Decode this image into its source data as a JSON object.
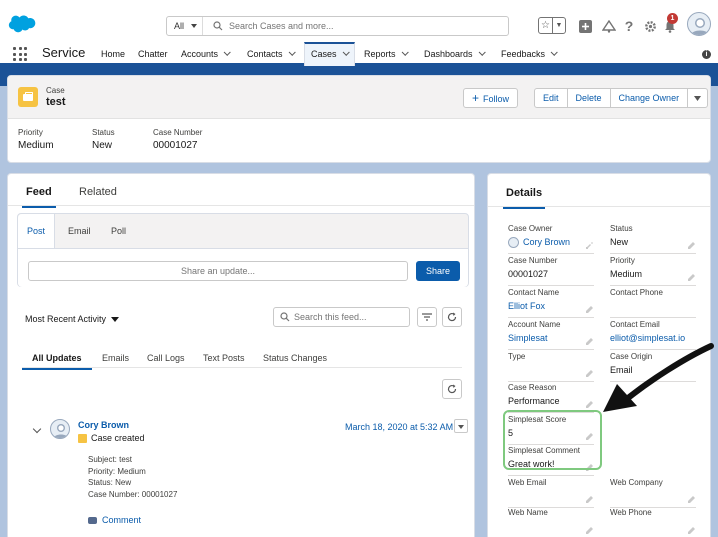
{
  "topbar": {
    "search_scope": "All",
    "search_placeholder": "Search Cases and more...",
    "notification_count": "1"
  },
  "nav": {
    "app_name": "Service",
    "items": [
      {
        "label": "Home",
        "has_menu": false
      },
      {
        "label": "Chatter",
        "has_menu": false
      },
      {
        "label": "Accounts",
        "has_menu": true
      },
      {
        "label": "Contacts",
        "has_menu": true
      },
      {
        "label": "Cases",
        "has_menu": true,
        "active": true
      },
      {
        "label": "Reports",
        "has_menu": true
      },
      {
        "label": "Dashboards",
        "has_menu": true
      },
      {
        "label": "Feedbacks",
        "has_menu": true
      }
    ]
  },
  "record": {
    "object_label": "Case",
    "title": "test",
    "buttons": {
      "follow": "Follow",
      "edit": "Edit",
      "delete": "Delete",
      "change_owner": "Change Owner"
    },
    "highlights": [
      {
        "label": "Priority",
        "value": "Medium"
      },
      {
        "label": "Status",
        "value": "New"
      },
      {
        "label": "Case Number",
        "value": "00001027"
      }
    ]
  },
  "feed": {
    "tabs": [
      "Feed",
      "Related"
    ],
    "publisher_tabs": [
      "Post",
      "Email",
      "Poll"
    ],
    "share_placeholder": "Share an update...",
    "share_button": "Share",
    "sort_label": "Most Recent Activity",
    "search_placeholder": "Search this feed...",
    "filter_tabs": [
      "All Updates",
      "Emails",
      "Call Logs",
      "Text Posts",
      "Status Changes"
    ],
    "post": {
      "author": "Cory Brown",
      "action": "Case created",
      "timestamp": "March 18, 2020 at 5:32 AM",
      "details": [
        "Subject: test",
        "Priority: Medium",
        "Status: New",
        "Case Number: 00001027"
      ],
      "comment_label": "Comment"
    }
  },
  "details": {
    "title": "Details",
    "fields": [
      {
        "label": "Case Owner",
        "value": "Cory Brown",
        "link": true
      },
      {
        "label": "Status",
        "value": "New",
        "link": false
      },
      {
        "label": "Case Number",
        "value": "00001027",
        "link": false
      },
      {
        "label": "Priority",
        "value": "Medium",
        "link": false
      },
      {
        "label": "Contact Name",
        "value": "Elliot Fox",
        "link": true
      },
      {
        "label": "Contact Phone",
        "value": "",
        "link": false
      },
      {
        "label": "Account Name",
        "value": "Simplesat",
        "link": true
      },
      {
        "label": "Contact Email",
        "value": "elliot@simplesat.io",
        "link": true
      },
      {
        "label": "Type",
        "value": "",
        "link": false
      },
      {
        "label": "Case Origin",
        "value": "Email",
        "link": false
      },
      {
        "label": "Case Reason",
        "value": "Performance",
        "link": false
      },
      {
        "label": "Simplesat Score",
        "value": "5",
        "link": false
      },
      {
        "label": "Simplesat Comment",
        "value": "Great work!",
        "link": false
      },
      {
        "label": "Web Email",
        "value": "",
        "link": false
      },
      {
        "label": "Web Company",
        "value": "",
        "link": false
      },
      {
        "label": "Web Name",
        "value": "",
        "link": false
      },
      {
        "label": "Web Phone",
        "value": "",
        "link": false
      }
    ]
  },
  "colors": {
    "brand_blue": "#0b5cab",
    "nav_band": "#1b5297",
    "case_icon": "#f6c343",
    "highlight_green": "#7fc97f"
  }
}
